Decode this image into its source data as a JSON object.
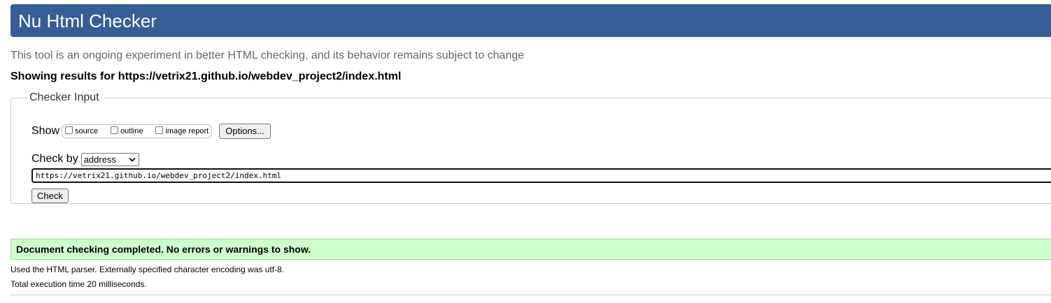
{
  "header": {
    "title": "Nu Html Checker",
    "background_color": "#365d95"
  },
  "tagline": "This tool is an ongoing experiment in better HTML checking, and its behavior remains subject to change",
  "results_heading": "Showing results for https://vetrix21.github.io/webdev_project2/index.html",
  "checker_input": {
    "legend": "Checker Input",
    "show_label": "Show",
    "show_options": [
      {
        "label": "source",
        "checked": false
      },
      {
        "label": "outline",
        "checked": false
      },
      {
        "label": "image report",
        "checked": false
      }
    ],
    "options_button": "Options...",
    "check_by_label": "Check by",
    "check_by_value": "address",
    "url_value": "https://vetrix21.github.io/webdev_project2/index.html",
    "check_button": "Check"
  },
  "result": {
    "message": "Document checking completed. No errors or warnings to show.",
    "success_color": "#ccffcc",
    "details": [
      "Used the HTML parser. Externally specified character encoding was utf-8.",
      "Total execution time 20 milliseconds."
    ]
  }
}
